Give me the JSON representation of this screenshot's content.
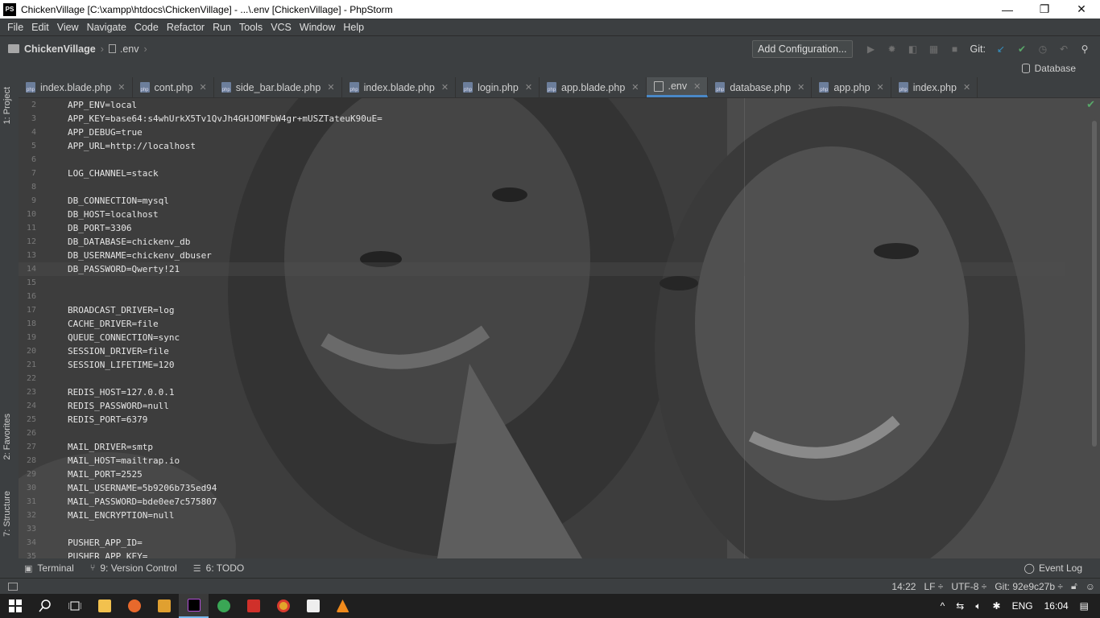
{
  "window": {
    "title": "ChickenVillage [C:\\xampp\\htdocs\\ChickenVillage] - ...\\.env [ChickenVillage] - PhpStorm",
    "app_icon": "PS",
    "minimize": "—",
    "restore": "❐",
    "close": "✕"
  },
  "menu": [
    "File",
    "Edit",
    "View",
    "Navigate",
    "Code",
    "Refactor",
    "Run",
    "Tools",
    "VCS",
    "Window",
    "Help"
  ],
  "breadcrumb": {
    "project": "ChickenVillage",
    "file": ".env"
  },
  "toolbar": {
    "config_button": "Add Configuration...",
    "git_label": "Git:"
  },
  "database_button": "Database",
  "left_tools": {
    "project": "1: Project",
    "favorites": "2: Favorites",
    "structure": "7: Structure"
  },
  "tabs": [
    {
      "label": "index.blade.php",
      "active": false,
      "type": "php"
    },
    {
      "label": "cont.php",
      "active": false,
      "type": "php"
    },
    {
      "label": "side_bar.blade.php",
      "active": false,
      "type": "php"
    },
    {
      "label": "index.blade.php",
      "active": false,
      "type": "php"
    },
    {
      "label": "login.php",
      "active": false,
      "type": "php"
    },
    {
      "label": "app.blade.php",
      "active": false,
      "type": "php"
    },
    {
      "label": ".env",
      "active": true,
      "type": "txt"
    },
    {
      "label": "database.php",
      "active": false,
      "type": "php"
    },
    {
      "label": "app.php",
      "active": false,
      "type": "php"
    },
    {
      "label": "index.php",
      "active": false,
      "type": "php"
    }
  ],
  "editor": {
    "lines": [
      {
        "n": "2",
        "code": "APP_ENV=local"
      },
      {
        "n": "3",
        "code": "APP_KEY=base64:s4whUrkX5Tv1QvJh4GHJOMFbW4gr+mUSZTateuK90uE="
      },
      {
        "n": "4",
        "code": "APP_DEBUG=true"
      },
      {
        "n": "5",
        "code": "APP_URL=http://localhost"
      },
      {
        "n": "6",
        "code": ""
      },
      {
        "n": "7",
        "code": "LOG_CHANNEL=stack"
      },
      {
        "n": "8",
        "code": ""
      },
      {
        "n": "9",
        "code": "DB_CONNECTION=mysql"
      },
      {
        "n": "10",
        "code": "DB_HOST=localhost"
      },
      {
        "n": "11",
        "code": "DB_PORT=3306"
      },
      {
        "n": "12",
        "code": "DB_DATABASE=chickenv_db"
      },
      {
        "n": "13",
        "code": "DB_USERNAME=chickenv_dbuser"
      },
      {
        "n": "14",
        "code": "DB_PASSWORD=Qwerty!21"
      },
      {
        "n": "15",
        "code": ""
      },
      {
        "n": "16",
        "code": ""
      },
      {
        "n": "17",
        "code": "BROADCAST_DRIVER=log"
      },
      {
        "n": "18",
        "code": "CACHE_DRIVER=file"
      },
      {
        "n": "19",
        "code": "QUEUE_CONNECTION=sync"
      },
      {
        "n": "20",
        "code": "SESSION_DRIVER=file"
      },
      {
        "n": "21",
        "code": "SESSION_LIFETIME=120"
      },
      {
        "n": "22",
        "code": ""
      },
      {
        "n": "23",
        "code": "REDIS_HOST=127.0.0.1"
      },
      {
        "n": "24",
        "code": "REDIS_PASSWORD=null"
      },
      {
        "n": "25",
        "code": "REDIS_PORT=6379"
      },
      {
        "n": "26",
        "code": ""
      },
      {
        "n": "27",
        "code": "MAIL_DRIVER=smtp"
      },
      {
        "n": "28",
        "code": "MAIL_HOST=mailtrap.io"
      },
      {
        "n": "29",
        "code": "MAIL_PORT=2525"
      },
      {
        "n": "30",
        "code": "MAIL_USERNAME=5b9206b735ed94"
      },
      {
        "n": "31",
        "code": "MAIL_PASSWORD=bde0ee7c575807"
      },
      {
        "n": "32",
        "code": "MAIL_ENCRYPTION=null"
      },
      {
        "n": "33",
        "code": ""
      },
      {
        "n": "34",
        "code": "PUSHER_APP_ID="
      },
      {
        "n": "35",
        "code": "PUSHER_APP_KEY="
      }
    ],
    "current_line": "14"
  },
  "bottom_tabs": [
    {
      "label": "Terminal",
      "icon": "terminal-icon"
    },
    {
      "label": "9: Version Control",
      "icon": "version-control-icon"
    },
    {
      "label": "6: TODO",
      "icon": "todo-icon"
    }
  ],
  "event_log": "Event Log",
  "status": {
    "position": "14:22",
    "line_sep": "LF ÷",
    "encoding": "UTF-8 ÷",
    "git_branch": "Git: 92e9c27b ÷"
  },
  "taskbar": {
    "tray_lang": "ENG",
    "clock": "16:04",
    "tray_chevron": "^"
  },
  "colors": {
    "accent": "#4a88c7",
    "background": "#3c3f41",
    "editor_text": "#e6e6e6",
    "git_check": "#59a869"
  }
}
